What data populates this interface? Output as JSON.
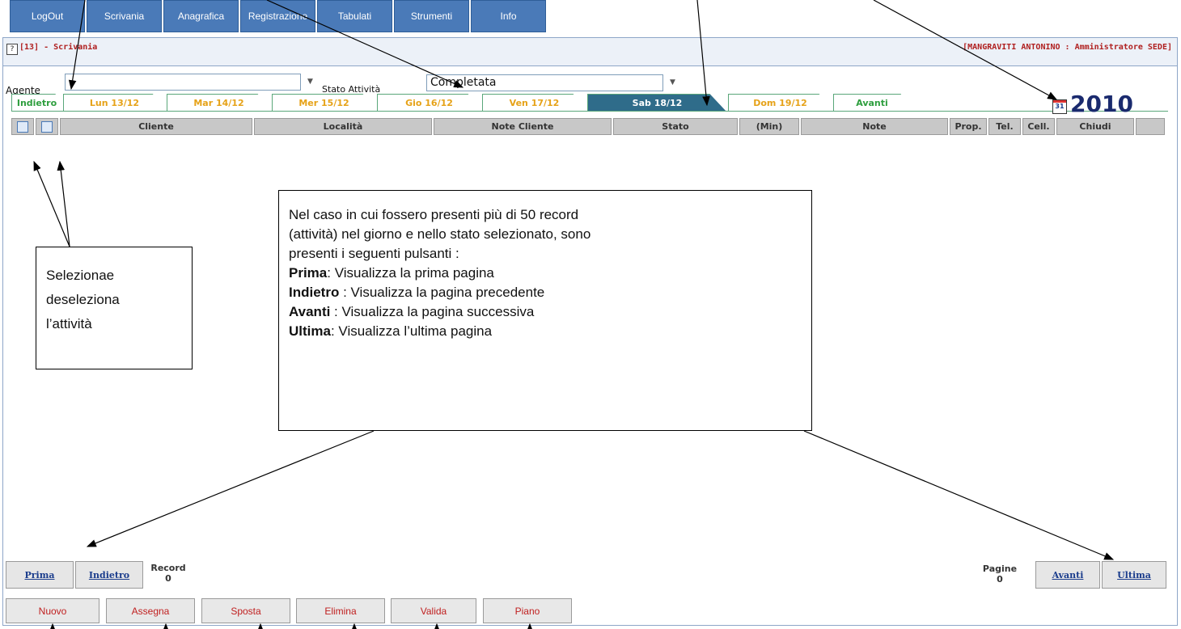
{
  "menu": [
    "LogOut",
    "Scrivania",
    "Anagrafica",
    "Registrazione",
    "Tabulati",
    "Strumenti",
    "Info"
  ],
  "header": {
    "help_icon": "?",
    "page_title": "[13] - Scrivania",
    "user_info": "[MANGRAVITI ANTONINO : Amministratore SEDE]"
  },
  "filters": {
    "agente_label": "Agente",
    "agente_value": "",
    "stato_label": "Stato Attività",
    "stato_value": "Completata"
  },
  "tabs": [
    "Indietro",
    "Lun 13/12",
    "Mar 14/12",
    "Mer 15/12",
    "Gio 16/12",
    "Ven 17/12",
    "Sab 18/12",
    "Dom 19/12",
    "Avanti"
  ],
  "active_tab": "Sab 18/12",
  "year": "2010",
  "calendar_icon_text": "31",
  "grid_columns": [
    "Cliente",
    "Località",
    "Note Cliente",
    "Stato",
    "(Min)",
    "Note",
    "Prop.",
    "Tel.",
    "Cell.",
    "Chiudi"
  ],
  "callout_select": [
    "Selezionae",
    "deseleziona",
    "l’attività"
  ],
  "callout_paging": {
    "intro": [
      "Nel caso in cui fossero presenti più di 50 record",
      "(attività) nel giorno e nello stato selezionato, sono",
      "presenti i seguenti pulsanti :"
    ],
    "items": [
      {
        "key": "Prima",
        "text": ": Visualizza la prima pagina"
      },
      {
        "key": "Indietro",
        "text": " : Visualizza la pagina precedente"
      },
      {
        "key": "Avanti",
        "text": " : Visualizza la pagina successiva"
      },
      {
        "key": "Ultima",
        "text": ": Visualizza l’ultima pagina"
      }
    ]
  },
  "pagination": {
    "prima": "Prima",
    "indietro": "Indietro",
    "record_label": "Record",
    "record_value": "0",
    "pagine_label": "Pagine",
    "pagine_value": "0",
    "avanti": "Avanti",
    "ultima": "Ultima"
  },
  "actions": [
    "Nuovo",
    "Assegna",
    "Sposta",
    "Elimina",
    "Valida",
    "Piano"
  ],
  "colors": {
    "menu_bg": "#4a7ab8",
    "title_red": "#b02020",
    "tab_orange": "#e6a218",
    "tab_green": "#2e9e3e",
    "tab_active": "#2f6c8a",
    "year_navy": "#1a2a6e",
    "link_blue": "#1a3c8c",
    "action_red": "#c02020"
  }
}
